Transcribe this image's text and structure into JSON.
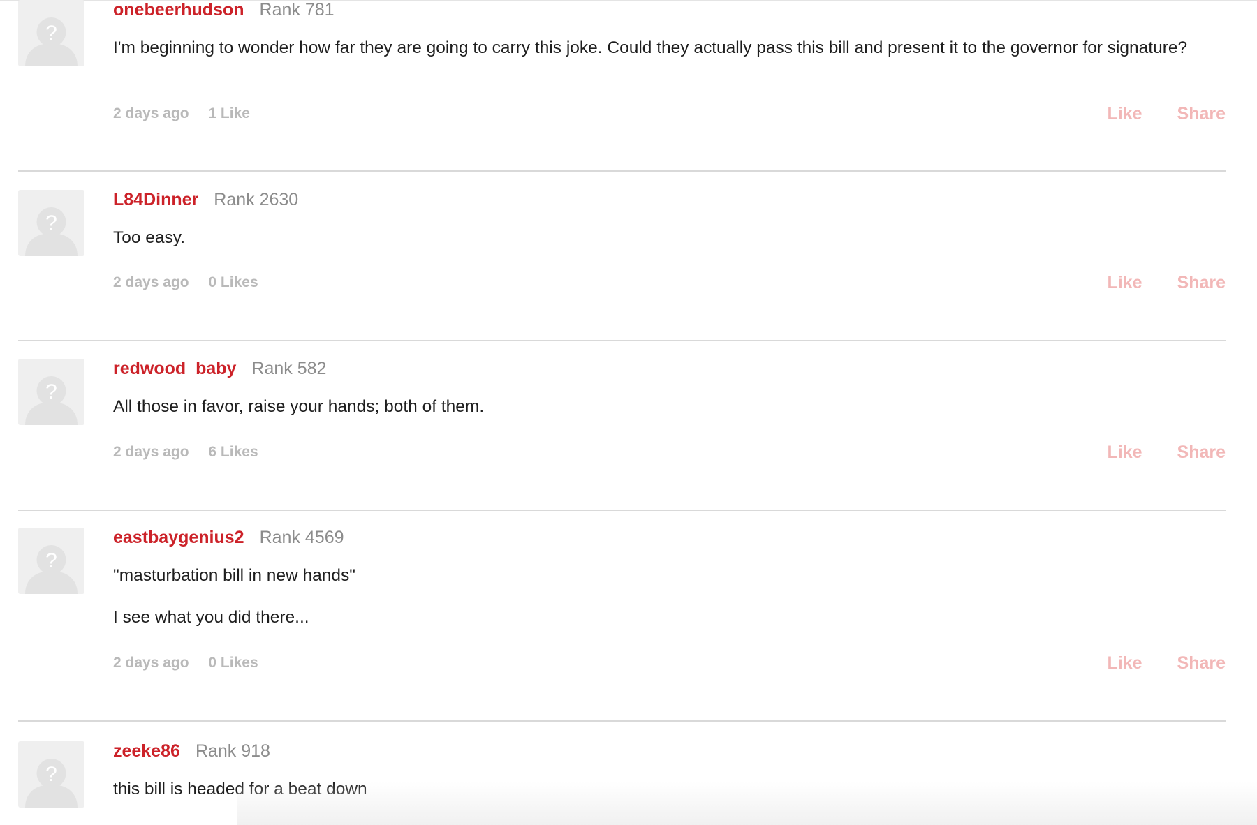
{
  "comments": [
    {
      "username": "onebeerhudson",
      "rank": "Rank 781",
      "paragraphs": [
        "I'm beginning to wonder how far they are going to carry this joke. Could they actually pass this bill and present it to the governor for signature?"
      ],
      "time": "2 days ago",
      "likes": "1 Like",
      "like_label": "Like",
      "share_label": "Share"
    },
    {
      "username": "L84Dinner",
      "rank": "Rank 2630",
      "paragraphs": [
        "Too easy."
      ],
      "time": "2 days ago",
      "likes": "0 Likes",
      "like_label": "Like",
      "share_label": "Share"
    },
    {
      "username": "redwood_baby",
      "rank": "Rank 582",
      "paragraphs": [
        "All those in favor, raise your hands; both of them."
      ],
      "time": "2 days ago",
      "likes": "6 Likes",
      "like_label": "Like",
      "share_label": "Share"
    },
    {
      "username": "eastbaygenius2",
      "rank": "Rank 4569",
      "paragraphs": [
        "\"masturbation bill in new hands\"",
        "I see what you did there..."
      ],
      "time": "2 days ago",
      "likes": "0 Likes",
      "like_label": "Like",
      "share_label": "Share"
    },
    {
      "username": "zeeke86",
      "rank": "Rank 918",
      "paragraphs": [
        "this bill is headed for a beat down"
      ]
    }
  ]
}
